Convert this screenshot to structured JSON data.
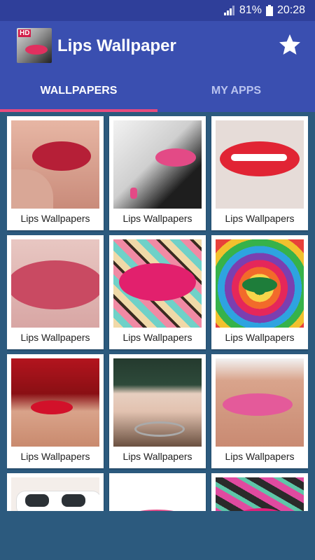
{
  "status": {
    "battery": "81%",
    "time": "20:28"
  },
  "app": {
    "title": "Lips Wallpaper",
    "icon_badge": "HD"
  },
  "tabs": [
    {
      "label": "WALLPAPERS"
    },
    {
      "label": "MY APPS"
    }
  ],
  "items": [
    {
      "caption": "Lips Wallpapers"
    },
    {
      "caption": "Lips Wallpapers"
    },
    {
      "caption": "Lips Wallpapers"
    },
    {
      "caption": "Lips Wallpapers"
    },
    {
      "caption": "Lips Wallpapers"
    },
    {
      "caption": "Lips Wallpapers"
    },
    {
      "caption": "Lips Wallpapers"
    },
    {
      "caption": "Lips Wallpapers"
    },
    {
      "caption": "Lips Wallpapers"
    }
  ],
  "colors": {
    "app_bar": "#3a4fb0",
    "status_bar": "#2f3f9a",
    "indicator": "#e84a7e",
    "background": "#2c5a7e"
  }
}
